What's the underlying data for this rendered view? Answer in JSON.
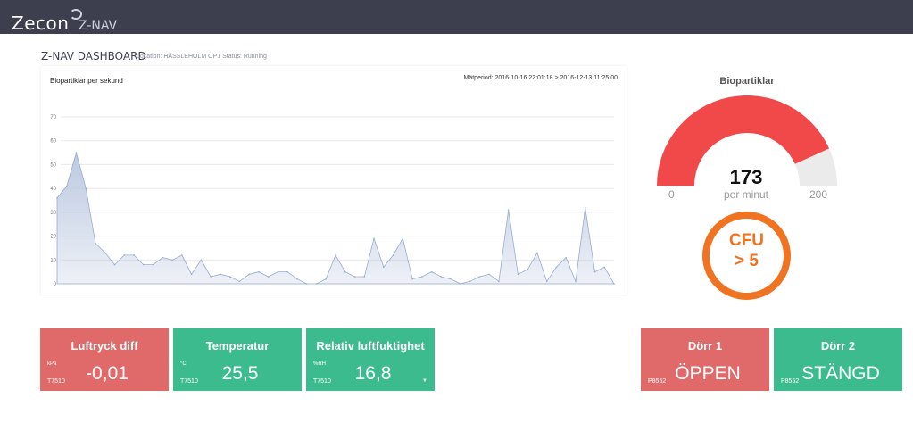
{
  "header": {
    "logo_text": "Zecon",
    "logo_sub": "Z-NAV"
  },
  "dashboard": {
    "title": "Z-NAV DASHBOARD",
    "meta": "Location: HÄSSLEHOLM OP1 Status: Running"
  },
  "chart_panel": {
    "title": "Biopartiklar per sekund",
    "period": "Mätperiod: 2016-10-16 22:01:18 > 2016-12-13 11:25:00"
  },
  "chart_data": {
    "type": "area",
    "title": "Biopartiklar per sekund",
    "ylim": [
      0,
      70
    ],
    "yticks": [
      "0",
      "10",
      "20",
      "30",
      "40",
      "50",
      "60",
      "70"
    ],
    "grid": true,
    "color": "#b9c6df",
    "line_color": "#9aaccd",
    "values": [
      36,
      41,
      55,
      40,
      17,
      13,
      8,
      12,
      12,
      8,
      8,
      11,
      10,
      12,
      4,
      10,
      3,
      4,
      3,
      1,
      4,
      5,
      3,
      5,
      5,
      2,
      0,
      0,
      2,
      12,
      5,
      3,
      3,
      19,
      7,
      12,
      19,
      2,
      3,
      5,
      3,
      2,
      0,
      1,
      3,
      4,
      1,
      31,
      4,
      6,
      13,
      1,
      7,
      11,
      1,
      32,
      5,
      7,
      0
    ]
  },
  "gauge": {
    "title": "Biopartiklar",
    "value": "173",
    "value_num": 173,
    "unit": "per minut",
    "min": "0",
    "max": "200",
    "min_num": 0,
    "max_num": 200,
    "fill_color": "#f1484a",
    "track_color": "#ebebeb"
  },
  "cfu": {
    "line1": "CFU",
    "line2": "> 5",
    "color": "#f07321"
  },
  "tiles": [
    {
      "title": "Luftryck diff",
      "unit": "kPa",
      "sensor": "T7510",
      "value": "-0,01",
      "status": "red"
    },
    {
      "title": "Temperatur",
      "unit": "°C",
      "sensor": "T7510",
      "value": "25,5",
      "status": "green"
    },
    {
      "title": "Relativ luftfuktighet",
      "unit": "%RH",
      "sensor": "T7510",
      "value": "16,8",
      "status": "green"
    },
    {
      "title": "Dörr 1",
      "unit": "",
      "sensor": "P8552",
      "value": "ÖPPEN",
      "status": "red"
    },
    {
      "title": "Dörr 2",
      "unit": "",
      "sensor": "P8552",
      "value": "STÄNGD",
      "status": "green"
    }
  ],
  "colors": {
    "topbar": "#3d3f4e",
    "tile_red": "#e06a6a",
    "tile_green": "#3cbb8f"
  }
}
